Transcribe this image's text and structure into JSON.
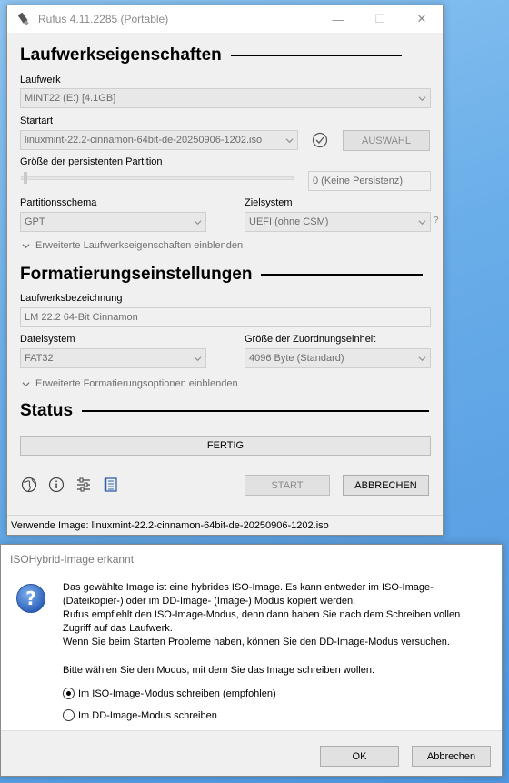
{
  "window": {
    "title": "Rufus 4.11.2285 (Portable)",
    "minimize_glyph": "—",
    "maximize_glyph": "☐",
    "close_glyph": "✕"
  },
  "drive_section": {
    "heading": "Laufwerkseigenschaften",
    "drive_label": "Laufwerk",
    "drive_value": "MINT22 (E:) [4.1GB]",
    "boot_label": "Startart",
    "boot_value": "linuxmint-22.2-cinnamon-64bit-de-20250906-1202.iso",
    "select_button": "AUSWAHL",
    "persistent_label": "Größe der persistenten Partition",
    "persistent_value": "0 (Keine Persistenz)",
    "persistent_slider": 0,
    "partition_label": "Partitionsschema",
    "partition_value": "GPT",
    "target_label": "Zielsystem",
    "target_value": "UEFI (ohne CSM)",
    "target_help": "?",
    "advanced_toggle": "Erweiterte Laufwerkseigenschaften einblenden"
  },
  "format_section": {
    "heading": "Formatierungseinstellungen",
    "volume_label": "Laufwerksbezeichnung",
    "volume_value": "LM 22.2 64-Bit Cinnamon",
    "fs_label": "Dateisystem",
    "fs_value": "FAT32",
    "cluster_label": "Größe der Zuordnungseinheit",
    "cluster_value": "4096 Byte (Standard)",
    "advanced_toggle": "Erweiterte Formatierungsoptionen einblenden"
  },
  "status_section": {
    "heading": "Status",
    "progress_text": "FERTIG",
    "start_button": "START",
    "cancel_button": "ABBRECHEN"
  },
  "statusbar": {
    "text": "Verwende Image: linuxmint-22.2-cinnamon-64bit-de-20250906-1202.iso"
  },
  "dialog": {
    "title": "ISOHybrid-Image erkannt",
    "para1_lines": [
      "Das gewählte Image ist eine hybrides ISO-Image. Es kann entweder im ISO-Image-",
      "(Dateikopier-) oder im DD-Image- (Image-) Modus kopiert werden.",
      "Rufus empfiehlt den ISO-Image-Modus, denn dann haben Sie nach dem Schreiben vollen",
      "Zugriff auf das Laufwerk.",
      "Wenn Sie beim Starten Probleme haben, können Sie den DD-Image-Modus versuchen."
    ],
    "prompt": "Bitte wählen Sie den Modus, mit dem Sie das Image schreiben wollen:",
    "option_iso": "Im ISO-Image-Modus schreiben (empfohlen)",
    "option_dd": "Im DD-Image-Modus schreiben",
    "selected_option": "iso",
    "ok_button": "OK",
    "cancel_button": "Abbrechen",
    "icon_glyph": "?"
  },
  "colors": {
    "accent_blue": "#2f5fa8",
    "dialog_icon": "#3a6fc4"
  }
}
